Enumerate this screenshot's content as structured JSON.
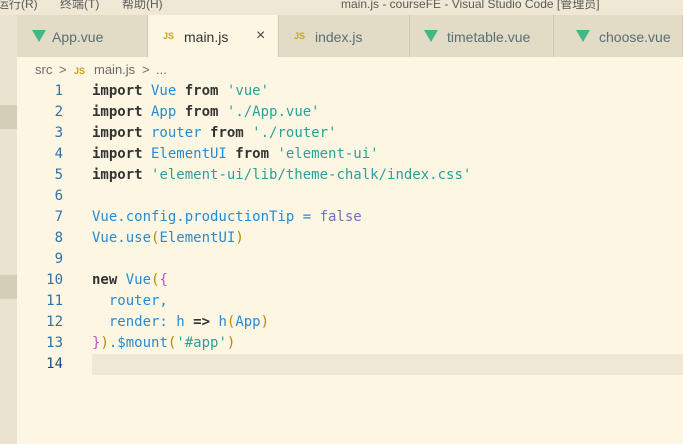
{
  "titlebar": {
    "menu": [
      {
        "label": "运行(R)"
      },
      {
        "label": "终端(T)"
      },
      {
        "label": "帮助(H)"
      }
    ],
    "window_title": "main.js - courseFE - Visual Studio Code [管理员]"
  },
  "tabs": [
    {
      "label": "App.vue",
      "icon": "vue-icon"
    },
    {
      "label": "main.js",
      "icon": "js-icon",
      "active": true,
      "close": "×"
    },
    {
      "label": "index.js",
      "icon": "js-icon"
    },
    {
      "label": "timetable.vue",
      "icon": "vue-icon"
    },
    {
      "label": "choose.vue",
      "icon": "vue-icon"
    }
  ],
  "tab_icons": {
    "js": "JS"
  },
  "breadcrumb": {
    "folder": "src",
    "separator": ">",
    "file_icon": "JS",
    "file": "main.js",
    "more": "..."
  },
  "code_lines": [
    {
      "n": "1",
      "tokens": [
        {
          "t": "import",
          "c": "kw"
        },
        {
          "t": " Vue ",
          "c": "plain"
        },
        {
          "t": "from",
          "c": "kw"
        },
        {
          "t": " ",
          "c": "plain"
        },
        {
          "t": "'vue'",
          "c": "str"
        }
      ]
    },
    {
      "n": "2",
      "tokens": [
        {
          "t": "import",
          "c": "kw"
        },
        {
          "t": " App ",
          "c": "plain"
        },
        {
          "t": "from",
          "c": "kw"
        },
        {
          "t": " ",
          "c": "plain"
        },
        {
          "t": "'./App.vue'",
          "c": "str"
        }
      ]
    },
    {
      "n": "3",
      "tokens": [
        {
          "t": "import",
          "c": "kw"
        },
        {
          "t": " router ",
          "c": "plain"
        },
        {
          "t": "from",
          "c": "kw"
        },
        {
          "t": " ",
          "c": "plain"
        },
        {
          "t": "'./router'",
          "c": "str"
        }
      ]
    },
    {
      "n": "4",
      "tokens": [
        {
          "t": "import",
          "c": "kw"
        },
        {
          "t": " ElementUI ",
          "c": "plain"
        },
        {
          "t": "from",
          "c": "kw"
        },
        {
          "t": " ",
          "c": "plain"
        },
        {
          "t": "'element-ui'",
          "c": "str"
        }
      ]
    },
    {
      "n": "5",
      "tokens": [
        {
          "t": "import",
          "c": "kw"
        },
        {
          "t": " ",
          "c": "plain"
        },
        {
          "t": "'element-ui/lib/theme-chalk/index.css'",
          "c": "str"
        }
      ]
    },
    {
      "n": "6",
      "tokens": []
    },
    {
      "n": "7",
      "tokens": [
        {
          "t": "Vue.config.productionTip = ",
          "c": "plain"
        },
        {
          "t": "false",
          "c": "bool"
        }
      ]
    },
    {
      "n": "8",
      "tokens": [
        {
          "t": "Vue.use",
          "c": "plain"
        },
        {
          "t": "(",
          "c": "br1"
        },
        {
          "t": "ElementUI",
          "c": "plain"
        },
        {
          "t": ")",
          "c": "br1"
        }
      ]
    },
    {
      "n": "9",
      "tokens": []
    },
    {
      "n": "10",
      "tokens": [
        {
          "t": "new",
          "c": "kw"
        },
        {
          "t": " Vue",
          "c": "plain"
        },
        {
          "t": "(",
          "c": "br1"
        },
        {
          "t": "{",
          "c": "br2"
        }
      ]
    },
    {
      "n": "11",
      "tokens": [
        {
          "t": "  router,",
          "c": "plain"
        }
      ]
    },
    {
      "n": "12",
      "tokens": [
        {
          "t": "  render: h ",
          "c": "plain"
        },
        {
          "t": "=>",
          "c": "kw"
        },
        {
          "t": " h",
          "c": "plain"
        },
        {
          "t": "(",
          "c": "br1"
        },
        {
          "t": "App",
          "c": "plain"
        },
        {
          "t": ")",
          "c": "br1"
        }
      ]
    },
    {
      "n": "13",
      "tokens": [
        {
          "t": "}",
          "c": "br2"
        },
        {
          "t": ")",
          "c": "br1"
        },
        {
          "t": ".$mount",
          "c": "plain"
        },
        {
          "t": "(",
          "c": "br1"
        },
        {
          "t": "'#app'",
          "c": "str"
        },
        {
          "t": ")",
          "c": "br1"
        }
      ]
    },
    {
      "n": "14",
      "tokens": [],
      "current": true
    }
  ],
  "colors": {
    "editor_bg": "#fdf6e3",
    "keyword": "#333333",
    "identifier": "#268bd2",
    "string": "#2aa198",
    "boolean": "#6c71c4",
    "vue_icon": "#41b883",
    "js_icon": "#c9a227"
  }
}
